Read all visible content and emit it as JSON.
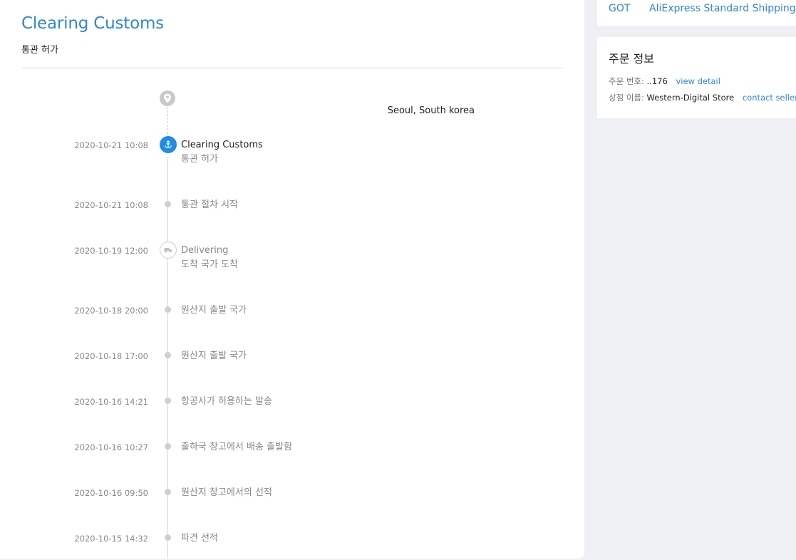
{
  "header": {
    "title": "Clearing Customs",
    "subtitle": "통관 허가"
  },
  "destination": {
    "address_line1": "",
    "address_line2": "Seoul,  South korea"
  },
  "events": [
    {
      "time": "2020-10-21 10:08",
      "status": "Clearing Customs",
      "detail": "통관 허가",
      "icon": "anchor-icon",
      "active": true
    },
    {
      "time": "2020-10-21 10:08",
      "status": "",
      "detail": "통관 절차 시작"
    },
    {
      "time": "2020-10-19 12:00",
      "status": "Delivering",
      "detail": "도착 국가 도착",
      "icon": "truck-icon"
    },
    {
      "time": "2020-10-18 20:00",
      "status": "",
      "detail": "원산지 출발 국가"
    },
    {
      "time": "2020-10-18 17:00",
      "status": "",
      "detail": "원산지 출발 국가"
    },
    {
      "time": "2020-10-16 14:21",
      "status": "",
      "detail": "항공사가 허용하는 발송"
    },
    {
      "time": "2020-10-16 10:27",
      "status": "",
      "detail": "출하국 창고에서 배송 출발함"
    },
    {
      "time": "2020-10-16 09:50",
      "status": "",
      "detail": "원산지 창고에서의 선적"
    },
    {
      "time": "2020-10-15 14:32",
      "status": "",
      "detail": "파견 선적"
    }
  ],
  "carrier": {
    "name": "GOT",
    "service": "AliExpress Standard Shipping"
  },
  "order_info": {
    "title": "주문 정보",
    "order_number_label": "주문 번호:",
    "order_number": "..176",
    "view_detail": "view detail",
    "store_label": "상점 이름:",
    "store_name": "Western-Digital Store",
    "contact_seller": "contact seller"
  },
  "colors": {
    "accent": "#2f86dc",
    "active_dot": "#1f8ce6",
    "background": "#eef0f4"
  }
}
